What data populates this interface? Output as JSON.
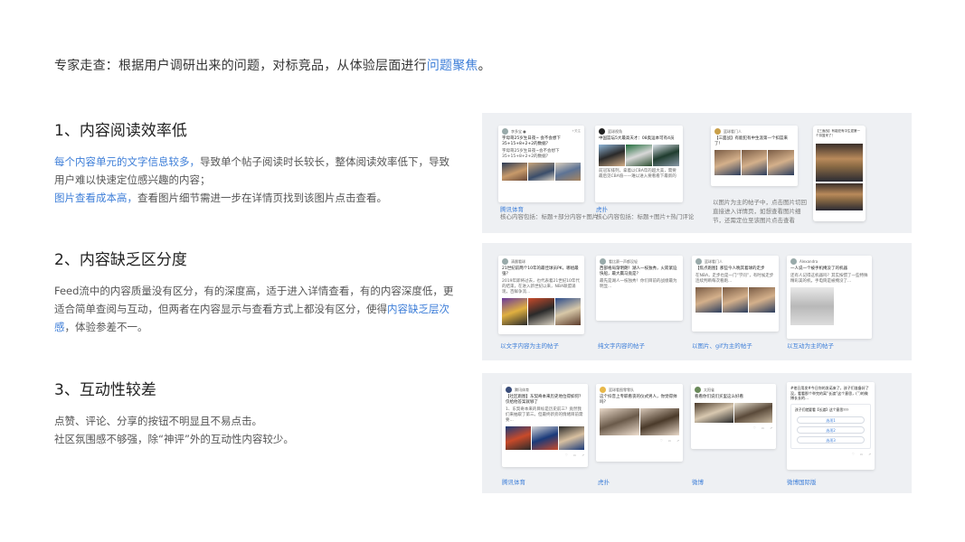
{
  "intro": {
    "text": "专家走查：根据用户调研出来的问题，对标竞品，从体验层面进行",
    "highlight": "问题聚焦",
    "end": "。"
  },
  "sections": [
    {
      "title": "1、内容阅读效率低",
      "hl1": "每个内容单元的文字信息较多，",
      "p1": "导致单个帖子阅读时长较长，整体阅读效率低下，导致",
      "p2": "用户难以快速定位感兴趣的内容；",
      "hl2": "图片查看成本高，",
      "p3": "查看图片细节需进一步在详情页找到该图片点击查看。"
    },
    {
      "title": "2、内容缺乏区分度",
      "p1": "Feed流中的内容质量没有区分，有的深度高，适于进入详情查看，有的内容深度低，更",
      "p2": "适合简单查阅与互动，但两者在内容显示与查看方式上都没有区分，使得",
      "hl1": "内容缺乏层次",
      "p3": "感",
      "p4": "，体验参差不一。"
    },
    {
      "title": "3、互动性较差",
      "p1": "点赞、评论、分享的按钮不明显且不易点击。",
      "p2": "社区氛围感不够强，除“神评”外的互动性内容较少。"
    }
  ],
  "panel1": {
    "cards": [
      {
        "name": "李多宝 ●",
        "follow": "+关注",
        "text": "字母哥25岁生日夜~\n会不会想下35+15+8+2+2的数据？",
        "text2": "字母哥25岁生日夜~会不会想下35+15+8+2+2的数据？"
      },
      {
        "name": "篮球视角",
        "text": "中国篮坛5大最高天才：08奥运本可有4员",
        "text2": "前冠军排列，拿着以CBA年的超大美，需要最后见CBA值——难以进入要看看下最新的"
      },
      {
        "name": "篮球看门人",
        "text": "【三面战】有能犯有中生涯第一个扣篮来了！",
        "text2": "有能犯有中生涯第一个扣篮来了！"
      },
      {
        "name": "",
        "text": "【三面战】有能犯有中生涯第一个扣篮来了！"
      }
    ],
    "captions": [
      {
        "app": "腾讯体育",
        "desc": "核心内容包括：标题+部分内容+图片"
      },
      {
        "app": "虎扑",
        "desc": "核心内容包括：标题+图片+热门评论"
      },
      {
        "desc": "以图片为主的帖子中，点击图片切回直接进入详情页，如想查看图片细节，还需定位至该图片点击查看"
      }
    ]
  },
  "panel2": {
    "cards": [
      {
        "name": "清晨看球",
        "text": "21世纪前两个10年的最佳球员PK，哪组最强？",
        "text2": "2019年即将过去，也代表着21世纪10年代的结束，在进入新世纪以来，NBA联盟涌现，百鲜争流..."
      },
      {
        "name": "看比赛一声都没轻",
        "text": "西部格局渐明朗！湖人一枝独秀，火箭紧迫快船，最大赢马竟是？",
        "text2": "最先是湖人一枝独秀！你们目前的战绩最为明显..."
      },
      {
        "name": "篮球看门人",
        "text": "【焦点跑图】那些今人晚其着球的走步",
        "text2": "在NBA，走步也是一门“学问”，有时候走步连续判断每次看跑..."
      },
      {
        "name": "Alexandra",
        "text": "一人说一个被手机掩没了的机器",
        "text2": "还有人记得这机器吗？其实按惯了一些特殊精彩美的机，手电筒是被掩没了..."
      }
    ],
    "captions": [
      "以文字内容为主的帖子",
      "纯文字内容的帖子",
      "以图片、gif为主的帖子",
      "以互动为主的帖子"
    ]
  },
  "panel3": {
    "cards": [
      {
        "name": "腾讯体育",
        "text": "【社区跑图】东契奇本来历史地位得如何？仅给他答案就够了",
        "text2": "1、东契奇本来的目标是历史前三？竟然我们来抽取了第三。但最终新旁的情绪目前需要..."
      },
      {
        "name": "篮球看图零零队",
        "text": "这个抖音上专职看丧的仪式男人，你觉得帅吗？"
      },
      {
        "name": "太阳雀",
        "text": "看看你们说们买里这么好看"
      },
      {
        "name": "",
        "text": "#他日用发#今日你的发诺来了，孩子们准备好了没，看看那个举完的离“长渡”这个意思，(’’)的微博长长的…",
        "vote_title": "孩子们就要看【长渡】这个意思???",
        "options": [
          "选项1",
          "选项2",
          "选项3"
        ]
      }
    ],
    "captions": [
      "腾讯体育",
      "虎扑",
      "微博",
      "微博国际版"
    ]
  }
}
